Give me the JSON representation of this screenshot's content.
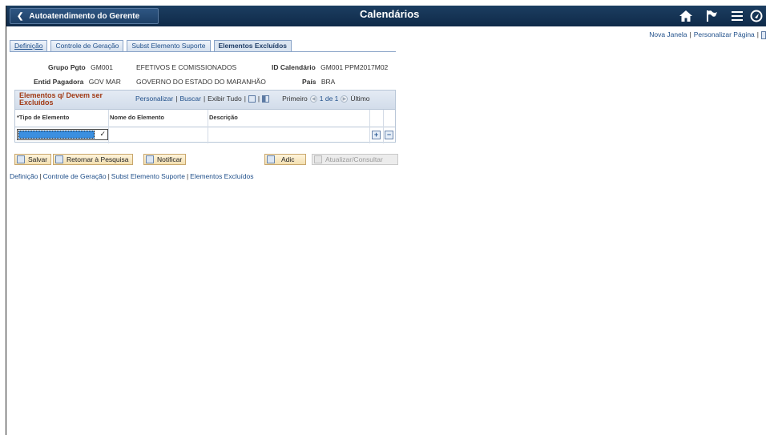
{
  "header": {
    "back_label": "Autoatendimento do Gerente",
    "title": "Calendários",
    "icons": [
      "home-icon",
      "flag-icon",
      "menu-icon",
      "navbar-icon"
    ]
  },
  "utility": {
    "new_window": "Nova Janela",
    "personalize": "Personalizar Página",
    "sep": "|"
  },
  "tabs": [
    {
      "label": "Definição"
    },
    {
      "label": "Controle de Geração"
    },
    {
      "label": "Subst Elemento Suporte"
    },
    {
      "label": "Elementos Excluídos"
    }
  ],
  "fields": {
    "grupo_label": "Grupo Pgto",
    "grupo_value": "GM001",
    "grupo_desc": "EFETIVOS E COMISSIONADOS",
    "id_cal_label": "ID Calendário",
    "id_cal_value": "GM001 PPM2017M02",
    "entid_label": "Entid Pagadora",
    "entid_value": "GOV MAR",
    "entid_desc": "GOVERNO DO ESTADO DO MARANHÃO",
    "pais_label": "País",
    "pais_value": "BRA"
  },
  "grid": {
    "title": "Elementos q/ Devem ser Excluídos",
    "personalize": "Personalizar",
    "search": "Buscar",
    "view_all": "Exibir Tudo",
    "first": "Primeiro",
    "range": "1 de 1",
    "last": "Último",
    "columns": [
      "*Tipo de Elemento",
      "Nome do Elemento",
      "Descrição"
    ],
    "rows": [
      {
        "tipo": "",
        "nome": "",
        "descricao": ""
      }
    ]
  },
  "buttons": {
    "save": "Salvar",
    "return": "Retornar à Pesquisa",
    "notify": "Notificar",
    "add": "Adic",
    "update": "Atualizar/Consultar"
  },
  "bottom_links": [
    {
      "label": "Definição"
    },
    {
      "label": "Controle de Geração"
    },
    {
      "label": "Subst Elemento Suporte"
    },
    {
      "label": "Elementos Excluídos"
    }
  ]
}
